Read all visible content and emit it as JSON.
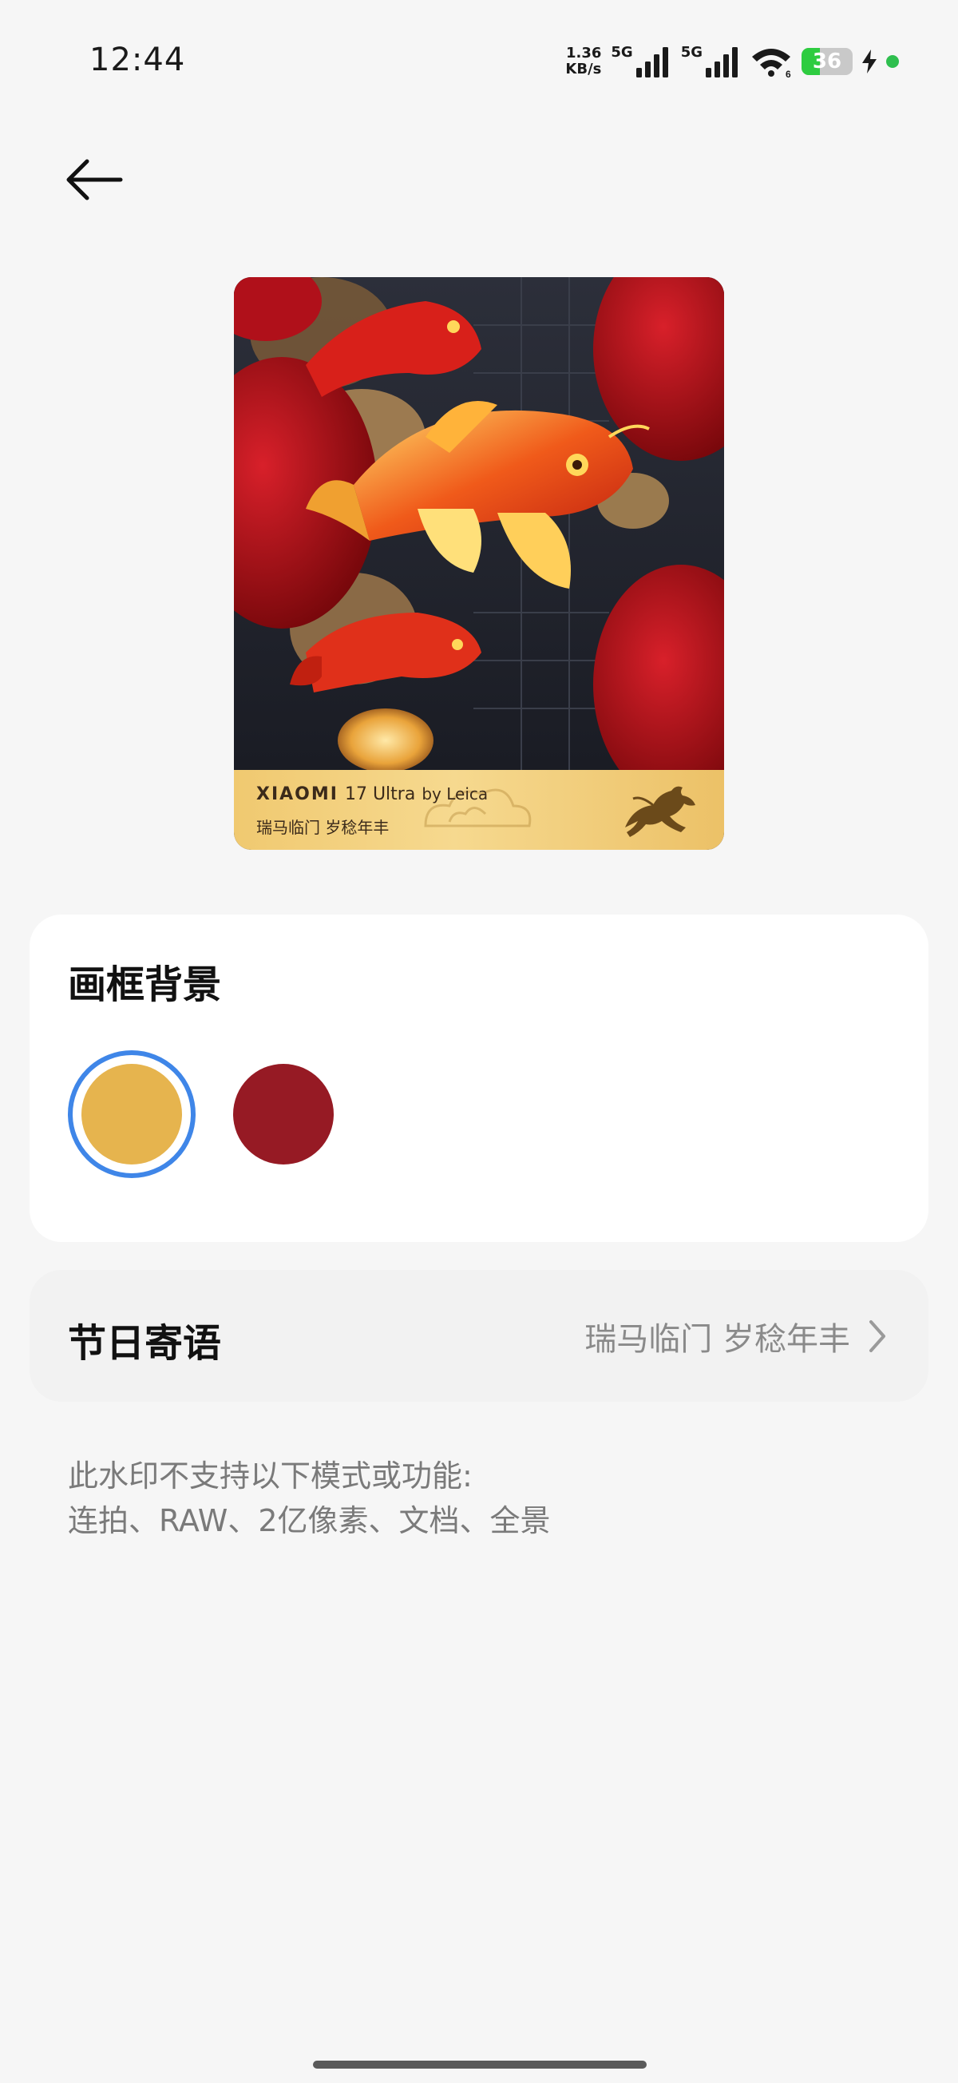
{
  "status_bar": {
    "time": "12:44",
    "net_speed_value": "1.36",
    "net_speed_unit": "KB/s",
    "sim1_tag": "5G",
    "sim2_tag": "5G",
    "wifi_badge": "6",
    "battery_level": "36",
    "charging": true,
    "indicator_color": "#2fbf4f"
  },
  "navigation": {
    "back_icon": "arrow-left-icon"
  },
  "preview": {
    "brand_logo": "XIAOMI",
    "model": "17 Ultra",
    "by_text": "by Leica",
    "blessing": "瑞马临门 岁稔年丰",
    "horse_icon": "horse-emblem-icon"
  },
  "frame_background": {
    "title": "画框背景",
    "options": [
      {
        "color": "#e6b44e",
        "selected": true
      },
      {
        "color": "#961a24",
        "selected": false
      }
    ],
    "selection_ring_color": "#3f86e8"
  },
  "holiday_message": {
    "label": "节日寄语",
    "value": "瑞马临门 岁稔年丰"
  },
  "notice": {
    "line1": "此水印不支持以下模式或功能:",
    "line2": "连拍、RAW、2亿像素、文档、全景"
  }
}
